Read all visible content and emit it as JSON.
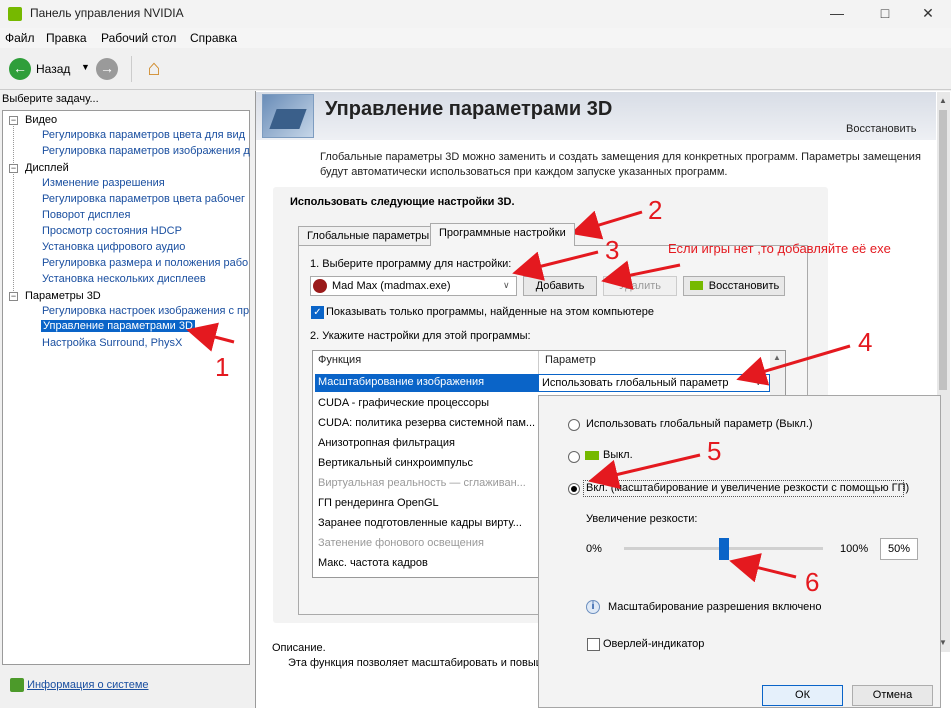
{
  "window": {
    "title": "Панель управления NVIDIA"
  },
  "menu": [
    "Файл",
    "Правка",
    "Рабочий стол",
    "Справка"
  ],
  "toolbar": {
    "back_label": "Назад"
  },
  "left": {
    "task_label": "Выберите задачу...",
    "tree": [
      {
        "label": "Видео",
        "kind": "group",
        "expander": "−"
      },
      {
        "label": "Регулировка параметров цвета для вид",
        "kind": "link"
      },
      {
        "label": "Регулировка параметров изображения д",
        "kind": "link"
      },
      {
        "label": "Дисплей",
        "kind": "group",
        "expander": "−"
      },
      {
        "label": "Изменение разрешения",
        "kind": "link"
      },
      {
        "label": "Регулировка параметров цвета рабочег",
        "kind": "link"
      },
      {
        "label": "Поворот дисплея",
        "kind": "link"
      },
      {
        "label": "Просмотр состояния HDCP",
        "kind": "link"
      },
      {
        "label": "Установка цифрового аудио",
        "kind": "link"
      },
      {
        "label": "Регулировка размера и положения рабо",
        "kind": "link"
      },
      {
        "label": "Установка нескольких дисплеев",
        "kind": "link"
      },
      {
        "label": "Параметры 3D",
        "kind": "group",
        "expander": "−"
      },
      {
        "label": "Регулировка настроек изображения с пр",
        "kind": "link"
      },
      {
        "label": "Управление параметрами 3D",
        "kind": "selected"
      },
      {
        "label": "Настройка Surround, PhysX",
        "kind": "link"
      }
    ],
    "system_info": "Информация о системе"
  },
  "main": {
    "title": "Управление параметрами 3D",
    "restore": "Восстановить",
    "description": "Глобальные параметры 3D можно заменить и создать замещения для конкретных программ. Параметры замещения будут автоматически использоваться при каждом запуске указанных программ.",
    "settings_label": "Использовать следующие настройки 3D.",
    "tabs": [
      "Глобальные параметры",
      "Программные настройки"
    ],
    "step1": "1. Выберите программу для настройки:",
    "program": "Mad Max (madmax.exe)",
    "add_button": "Добавить",
    "remove_button": "Удалить",
    "restore_button": "Восстановить",
    "show_only": "Показывать только программы, найденные на этом компьютере",
    "step2": "2. Укажите настройки для этой программы:",
    "table_headers": [
      "Функция",
      "Параметр"
    ],
    "features": [
      {
        "label": "Масштабирование изображения",
        "state": "selected"
      },
      {
        "label": "CUDA - графические процессоры",
        "state": "normal"
      },
      {
        "label": "CUDA: политика резерва системной пам...",
        "state": "normal"
      },
      {
        "label": "Анизотропная фильтрация",
        "state": "normal"
      },
      {
        "label": "Вертикальный синхроимпульс",
        "state": "normal"
      },
      {
        "label": "Виртуальная реальность — сглаживан...",
        "state": "disabled"
      },
      {
        "label": "ГП рендеринга OpenGL",
        "state": "normal"
      },
      {
        "label": "Заранее подготовленные кадры вирту...",
        "state": "normal"
      },
      {
        "label": "Затенение фонового освещения",
        "state": "disabled"
      },
      {
        "label": "Макс. частота кадров",
        "state": "normal"
      }
    ],
    "selected_value": "Использовать глобальный параметр",
    "description_label": "Описание.",
    "description_text": "Эта функция позволяет масштабировать и повыш"
  },
  "popup": {
    "option_global": "Использовать глобальный параметр (Выкл.)",
    "option_off": "Выкл.",
    "option_on": "Вкл. (масштабирование и увеличение резкости с помощью ГП)",
    "sharpness_label": "Увеличение резкости:",
    "min": "0%",
    "max": "100%",
    "value": "50%",
    "sharpness": 0.5,
    "info": "Масштабирование разрешения включено",
    "overlay": "Оверлей-индикатор",
    "ok": "ОК",
    "cancel": "Отмена"
  },
  "annotations": {
    "n1": "1",
    "n2": "2",
    "n3": "3",
    "n4": "4",
    "n5": "5",
    "n6": "6",
    "note": "Если игры нет ,то добавляйте её exe",
    "color": "#e4191f"
  }
}
